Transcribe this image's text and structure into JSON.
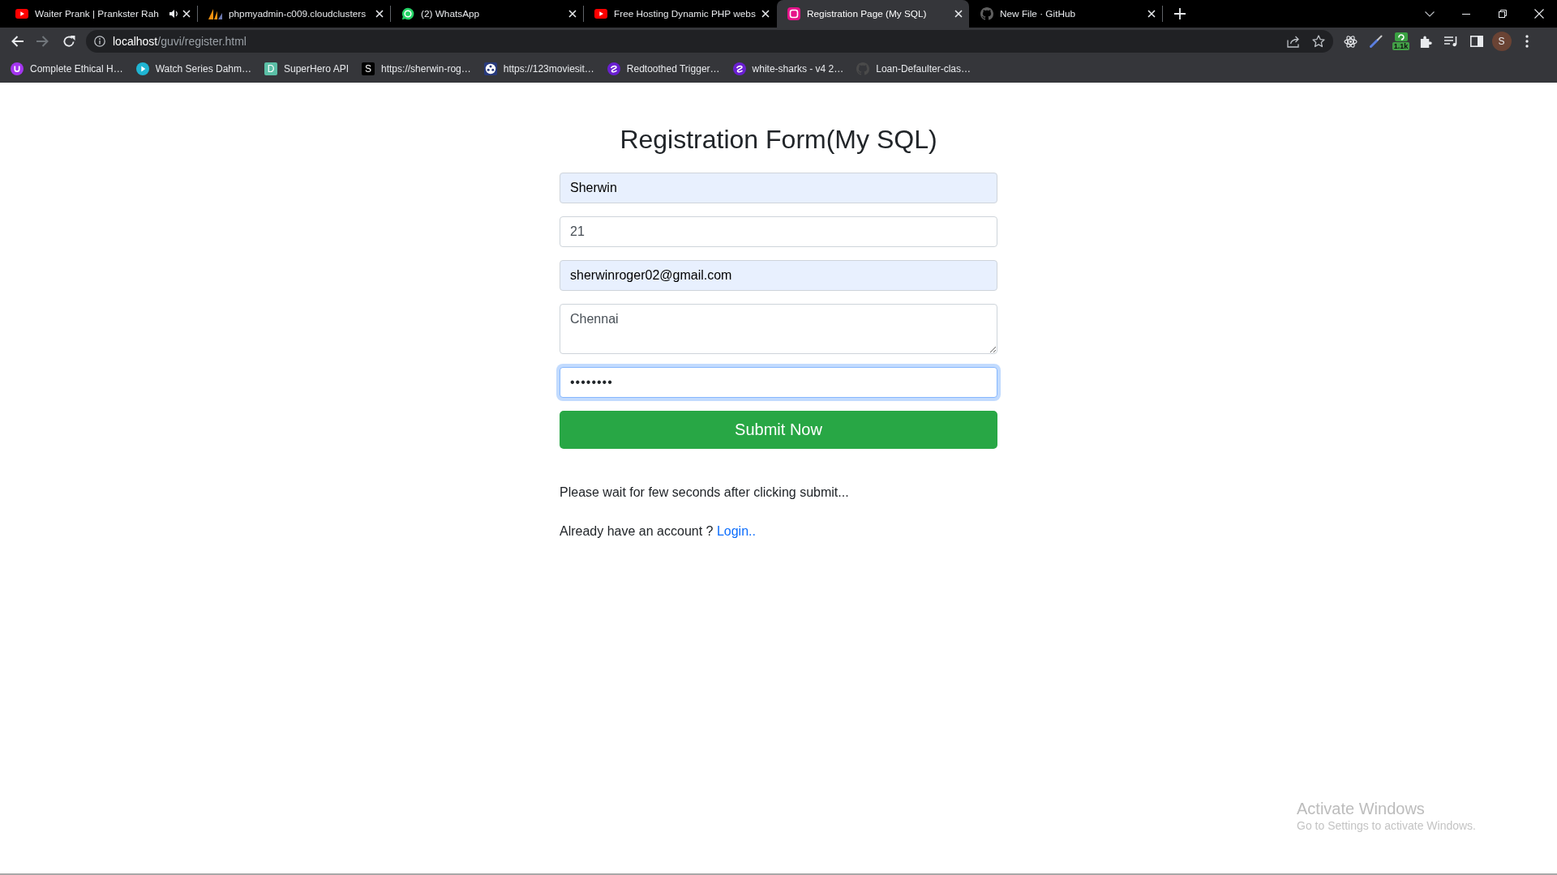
{
  "browser": {
    "tabs": [
      {
        "title": "Waiter Prank | Prankster Rah",
        "audio": true,
        "selected": false
      },
      {
        "title": "phpmyadmin-c009.cloudclusters",
        "audio": false,
        "selected": false
      },
      {
        "title": "(2) WhatsApp",
        "audio": false,
        "selected": false
      },
      {
        "title": "Free Hosting Dynamic PHP webs",
        "audio": false,
        "selected": false
      },
      {
        "title": "Registration Page (My SQL)",
        "audio": false,
        "selected": true
      },
      {
        "title": "New File · GitHub",
        "audio": false,
        "selected": false
      }
    ],
    "address_bar": {
      "host": "localhost",
      "path": "/guvi/register.html"
    },
    "extension_count": "1.1k",
    "profile_initial": "S",
    "bookmarks": [
      {
        "title": "Complete Ethical H…"
      },
      {
        "title": "Watch Series Dahm…"
      },
      {
        "title": "SuperHero API",
        "icon_letter": "D"
      },
      {
        "title": "https://sherwin-rog…",
        "icon_letter": "S"
      },
      {
        "title": "https://123moviesit…"
      },
      {
        "title": "Redtoothed Trigger…"
      },
      {
        "title": "white-sharks - v4 2…"
      },
      {
        "title": "Loan-Defaulter-clas…"
      }
    ]
  },
  "page": {
    "title": "Registration Form(My SQL)",
    "fields": [
      {
        "kind": "text",
        "value": "Sherwin",
        "autofilled": true,
        "focused": false
      },
      {
        "kind": "text",
        "value": "21",
        "autofilled": false,
        "focused": false
      },
      {
        "kind": "text",
        "value": "sherwinroger02@gmail.com",
        "autofilled": true,
        "focused": false
      },
      {
        "kind": "textarea",
        "value": "Chennai",
        "autofilled": false,
        "focused": false
      },
      {
        "kind": "password",
        "value": "••••••••",
        "autofilled": false,
        "focused": true
      }
    ],
    "submit_button": "Submit Now",
    "wait_note": "Please wait for few seconds after clicking submit...",
    "login_prompt": {
      "text": "Already have an account ?",
      "link": "Login.."
    }
  },
  "activation_notice": {
    "title": "Activate Windows",
    "message": "Go to Settings to activate Windows."
  }
}
